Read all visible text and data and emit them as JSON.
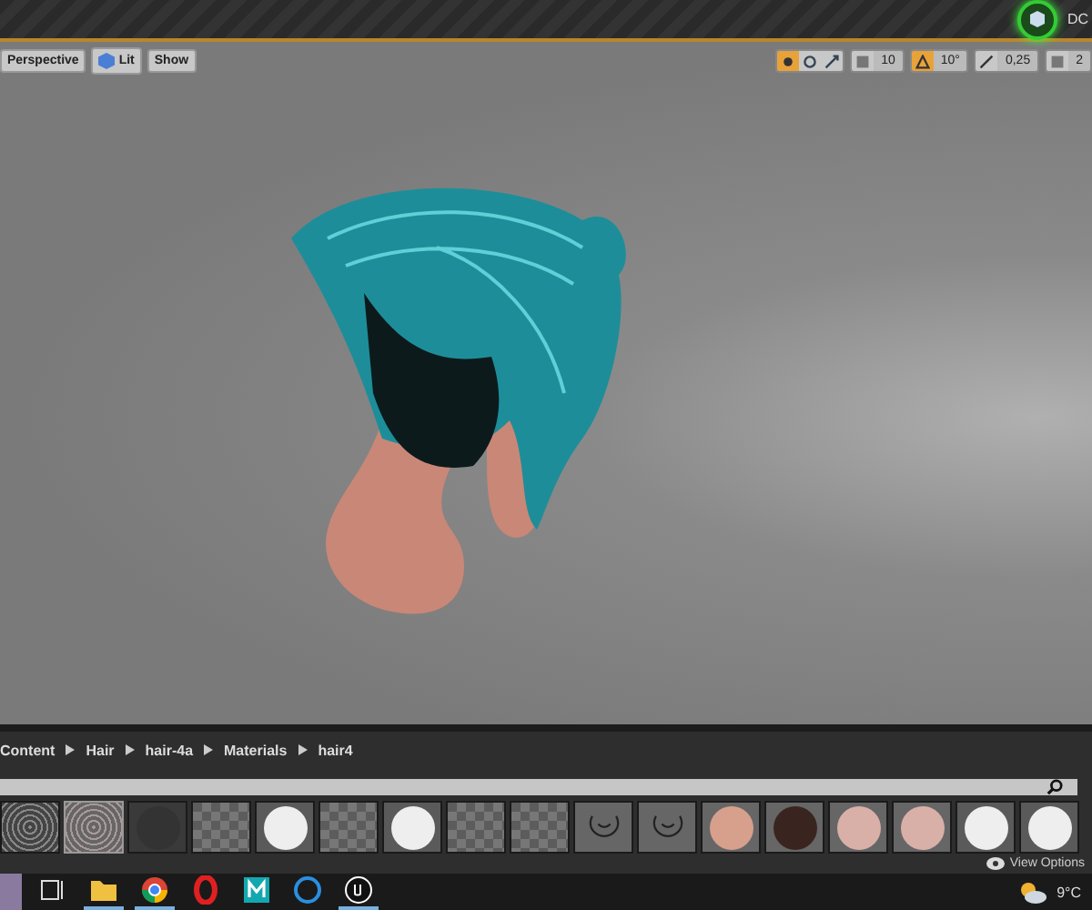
{
  "title_bar": {
    "tab_text": "DC"
  },
  "viewport_toolbar": {
    "left_buttons": [
      {
        "label": "Perspective",
        "kind": "view"
      },
      {
        "label": "Lit",
        "kind": "lit"
      },
      {
        "label": "Show",
        "kind": "plain"
      }
    ],
    "transform_modes": [
      {
        "kind": "move",
        "selected": true
      },
      {
        "kind": "rotate",
        "selected": false
      },
      {
        "kind": "scale",
        "selected": false
      }
    ],
    "snaps": [
      {
        "kind": "grid",
        "value": "10",
        "on": false
      },
      {
        "kind": "angle",
        "value": "10°",
        "on": true
      },
      {
        "kind": "scale",
        "value": "0,25",
        "on": false
      },
      {
        "kind": "camera",
        "value": "2",
        "on": false
      }
    ]
  },
  "breadcrumb": [
    "Content",
    "Hair",
    "hair-4a",
    "Materials",
    "hair4"
  ],
  "thumbnails": [
    {
      "kind": "noise",
      "selected": false
    },
    {
      "kind": "noise",
      "selected": true
    },
    {
      "kind": "rock",
      "selected": false
    },
    {
      "kind": "checker",
      "selected": false
    },
    {
      "kind": "white",
      "selected": false
    },
    {
      "kind": "checker",
      "selected": false
    },
    {
      "kind": "white",
      "selected": false
    },
    {
      "kind": "checker",
      "selected": false
    },
    {
      "kind": "checker",
      "selected": false
    },
    {
      "kind": "outline",
      "selected": false
    },
    {
      "kind": "outline",
      "selected": false
    },
    {
      "kind": "skin",
      "selected": false
    },
    {
      "kind": "skin-dark",
      "selected": false
    },
    {
      "kind": "face",
      "selected": false
    },
    {
      "kind": "face",
      "selected": false
    },
    {
      "kind": "white",
      "selected": false
    },
    {
      "kind": "white",
      "selected": false
    }
  ],
  "view_options": "View Options",
  "taskbar": {
    "apps": [
      {
        "kind": "task-view",
        "running": false
      },
      {
        "kind": "folder",
        "running": true
      },
      {
        "kind": "browser",
        "running": true
      },
      {
        "kind": "opera",
        "running": false
      },
      {
        "kind": "m-app",
        "running": false
      },
      {
        "kind": "c-app",
        "running": false
      },
      {
        "kind": "unreal",
        "running": true
      }
    ],
    "temperature": "9°C"
  }
}
